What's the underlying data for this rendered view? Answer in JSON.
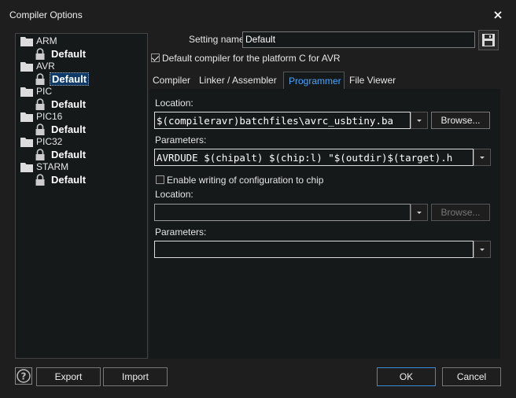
{
  "window": {
    "title": "Compiler Options"
  },
  "tree": {
    "groups": [
      {
        "name": "ARM",
        "child": "Default"
      },
      {
        "name": "AVR",
        "child": "Default"
      },
      {
        "name": "PIC",
        "child": "Default"
      },
      {
        "name": "PIC16",
        "child": "Default"
      },
      {
        "name": "PIC32",
        "child": "Default"
      },
      {
        "name": "STARM",
        "child": "Default"
      }
    ]
  },
  "setting": {
    "label": "Setting name:",
    "value": "Default",
    "default_checkbox_label": "Default compiler for the platform C for AVR"
  },
  "tabs": [
    {
      "label": "Compiler"
    },
    {
      "label": "Linker / Assembler"
    },
    {
      "label": "Programmer"
    },
    {
      "label": "File Viewer"
    }
  ],
  "programmer": {
    "location_label": "Location:",
    "location_value": "$(compileravr)batchfiles\\avrc_usbtiny.ba",
    "browse_label": "Browse...",
    "parameters_label": "Parameters:",
    "parameters_value": "AVRDUDE $(chipalt) $(chip:l) \"$(outdir)$(target).h",
    "config_checkbox_label": "Enable writing of configuration to chip",
    "config_location_label": "Location:",
    "config_location_value": "",
    "config_browse_label": "Browse...",
    "config_parameters_label": "Parameters:",
    "config_parameters_value": ""
  },
  "footer": {
    "export_label": "Export",
    "import_label": "Import",
    "ok_label": "OK",
    "cancel_label": "Cancel"
  }
}
